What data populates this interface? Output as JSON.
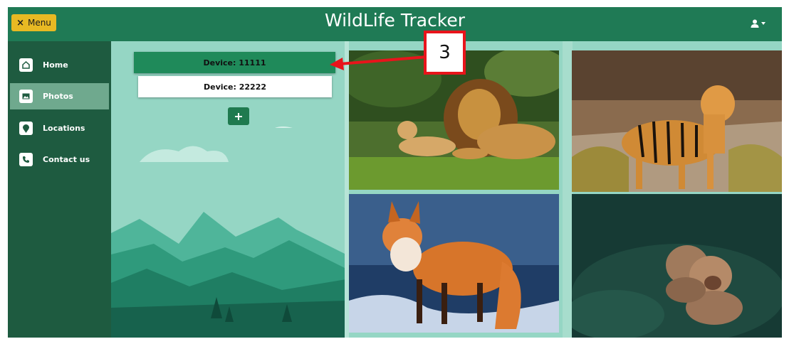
{
  "header": {
    "menu_label": "Menu",
    "menu_x": "×",
    "title": "WildLife Tracker"
  },
  "sidebar": {
    "items": [
      {
        "label": "Home",
        "icon": "home-icon"
      },
      {
        "label": "Photos",
        "icon": "image-icon",
        "active": true
      },
      {
        "label": "Locations",
        "icon": "map-pin-icon"
      },
      {
        "label": "Contact us",
        "icon": "phone-icon"
      }
    ]
  },
  "devices": [
    {
      "label": "Device: 11111",
      "selected": true
    },
    {
      "label": "Device: 22222",
      "selected": false
    }
  ],
  "add_button": {
    "icon": "plus-icon"
  },
  "photos": [
    {
      "subject": "lion-with-cub"
    },
    {
      "subject": "tiger"
    },
    {
      "subject": "red-fox"
    },
    {
      "subject": "lionesses"
    }
  ],
  "annotation": {
    "number": "3",
    "color": "#e8141b"
  },
  "colors": {
    "header": "#1f7a55",
    "sidebar": "#1e5b40",
    "sidebar_active": "#6fa98e",
    "menu_button": "#e8b923",
    "device_selected": "#1f8a5a"
  }
}
